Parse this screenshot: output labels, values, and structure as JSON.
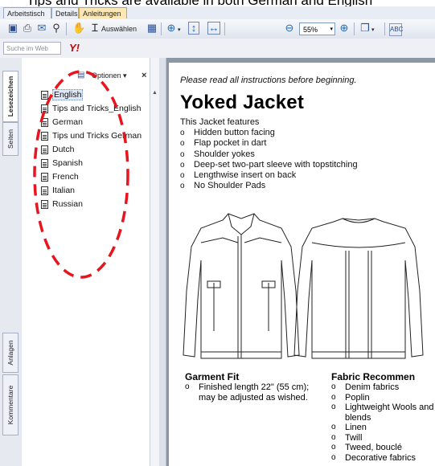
{
  "caption": "Tips and Tricks are available in both German and English",
  "tabs": [
    {
      "label": "Arbeitstisch",
      "active": false
    },
    {
      "label": "Details",
      "active": false
    },
    {
      "label": "Anleitungen",
      "active": true
    }
  ],
  "toolbar": {
    "select_label": "Auswählen",
    "zoom_value": "55%",
    "icons": [
      "save-icon",
      "print-icon",
      "email-icon",
      "find-icon",
      "hand-icon",
      "select-text-icon",
      "snapshot-icon",
      "zoom-in-icon",
      "fit-page-icon",
      "fit-width-icon",
      "zoom-out-icon",
      "zoom-plus-icon",
      "pages-icon",
      "spellcheck-icon"
    ]
  },
  "searchbar": {
    "placeholder": "Suche im Web",
    "logo": "Y!"
  },
  "sidetabs": [
    {
      "label": "Lesezeichen",
      "active": true
    },
    {
      "label": "Seiten",
      "active": false
    },
    {
      "label": "Anlagen",
      "active": false
    },
    {
      "label": "Kommentare",
      "active": false
    }
  ],
  "panel": {
    "options_label": "Optionen ▾",
    "close": "×",
    "bookmarks": [
      {
        "label": "English",
        "selected": true
      },
      {
        "label": "Tips and Tricks_English",
        "selected": false
      },
      {
        "label": "German",
        "selected": false
      },
      {
        "label": "Tips und Tricks German",
        "selected": false
      },
      {
        "label": "Dutch",
        "selected": false
      },
      {
        "label": "Spanish",
        "selected": false
      },
      {
        "label": "French",
        "selected": false
      },
      {
        "label": "Italian",
        "selected": false
      },
      {
        "label": "Russian",
        "selected": false
      }
    ]
  },
  "annotation": {
    "color": "#e8141e",
    "shape": "dashed-oval"
  },
  "document": {
    "instructions": "Please read all instructions before beginning.",
    "title": "Yoked Jacket",
    "features_intro": "This Jacket features",
    "features": [
      "Hidden button facing",
      "Flap pocket in dart",
      "Shoulder yokes",
      "Deep-set two-part sleeve with topstitching",
      "Lengthwise insert on back",
      "No Shoulder Pads"
    ],
    "garment_fit": {
      "heading": "Garment Fit",
      "items": [
        "Finished length 22\" (55 cm); may be adjusted as wished."
      ]
    },
    "fabric": {
      "heading": "Fabric Recommen",
      "items": [
        "Denim fabrics",
        "Poplin",
        "Lightweight Wools and blends",
        "Linen",
        "Twill",
        "Tweed, bouclé",
        "Decorative fabrics"
      ]
    }
  }
}
